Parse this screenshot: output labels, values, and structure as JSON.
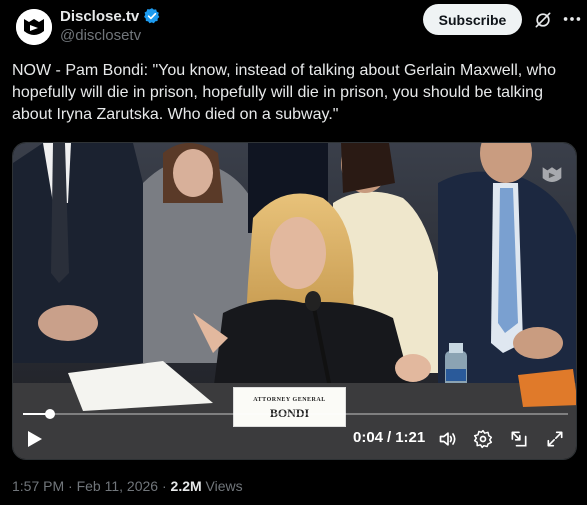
{
  "post": {
    "author_name": "Disclose.tv",
    "handle": "@disclosetv",
    "subscribe_label": "Subscribe",
    "text": "NOW - Pam Bondi: \"You know, instead of talking about Gerlain Maxwell, who hopefully will die in prison, hopefully will die in prison, you should be talking about Iryna Zarutska. Who died on a subway.\"",
    "time": "1:57 PM",
    "separator": "·",
    "date": "Feb 11, 2026",
    "views_count": "2.2M",
    "views_label": "Views"
  },
  "video": {
    "nameplate_title": "ATTORNEY GENERAL",
    "nameplate_name": "BONDI",
    "current_time": "0:04",
    "time_separator": "/",
    "duration": "1:21",
    "progress": 0.05
  },
  "icons": {
    "avatar": "disclose-logo-icon",
    "verified": "verified-badge-icon",
    "grok": "grok-icon",
    "more": "more-dots-icon",
    "play": "play-icon",
    "volume": "volume-icon",
    "settings": "settings-gear-icon",
    "pip": "picture-in-picture-icon",
    "fullscreen": "fullscreen-icon",
    "watermark": "disclose-watermark-icon"
  },
  "colors": {
    "background": "#000000",
    "text_primary": "#e7e9ea",
    "text_secondary": "#71767b",
    "verified": "#1d9bf0",
    "button_bg": "#eff3f4"
  }
}
